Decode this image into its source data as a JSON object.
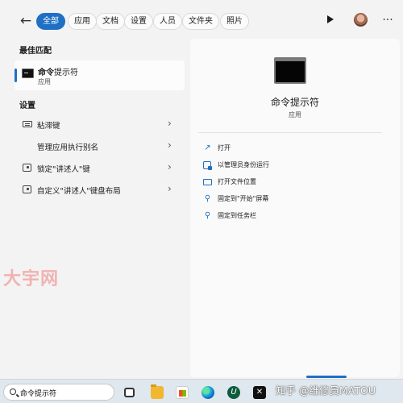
{
  "topbar": {
    "back_label": "←",
    "filters": [
      {
        "label": "全部",
        "active": true
      },
      {
        "label": "应用",
        "active": false
      },
      {
        "label": "文档",
        "active": false
      },
      {
        "label": "设置",
        "active": false
      },
      {
        "label": "人员",
        "active": false
      },
      {
        "label": "文件夹",
        "active": false
      },
      {
        "label": "照片",
        "active": false
      }
    ],
    "more_label": "···"
  },
  "best_match": {
    "title": "最佳匹配",
    "item": {
      "name_bold": "命令",
      "name_rest": "提示符",
      "type": "应用"
    }
  },
  "settings": {
    "title": "设置",
    "items": [
      {
        "label": "粘滞键",
        "icon": "keyboard-icon"
      },
      {
        "label": "管理应用执行别名",
        "icon": "none"
      },
      {
        "label": "锁定\"讲述人\"键",
        "icon": "lock-icon"
      },
      {
        "label": "自定义\"讲述人\"键盘布局",
        "icon": "lock-icon"
      }
    ],
    "chevron": "›"
  },
  "preview": {
    "title": "命令提示符",
    "subtitle": "应用",
    "actions": [
      {
        "label": "打开",
        "icon": "open-icon"
      },
      {
        "label": "以管理员身份运行",
        "icon": "shield-icon"
      },
      {
        "label": "打开文件位置",
        "icon": "folder-icon"
      },
      {
        "label": "固定到\"开始\"屏幕",
        "icon": "pin-icon"
      },
      {
        "label": "固定到任务栏",
        "icon": "pin-icon"
      }
    ]
  },
  "watermark": "大宇网",
  "taskbar": {
    "search_value": "命令提示符",
    "icons": [
      "task-view-icon",
      "file-explorer-icon",
      "store-icon",
      "edge-icon",
      "upwork-icon",
      "capcut-icon"
    ],
    "upwork_glyph": "U",
    "capcut_glyph": "✕"
  },
  "overlay_text": "知乎 @维修员MATOU",
  "colors": {
    "accent": "#1f6fc5"
  }
}
